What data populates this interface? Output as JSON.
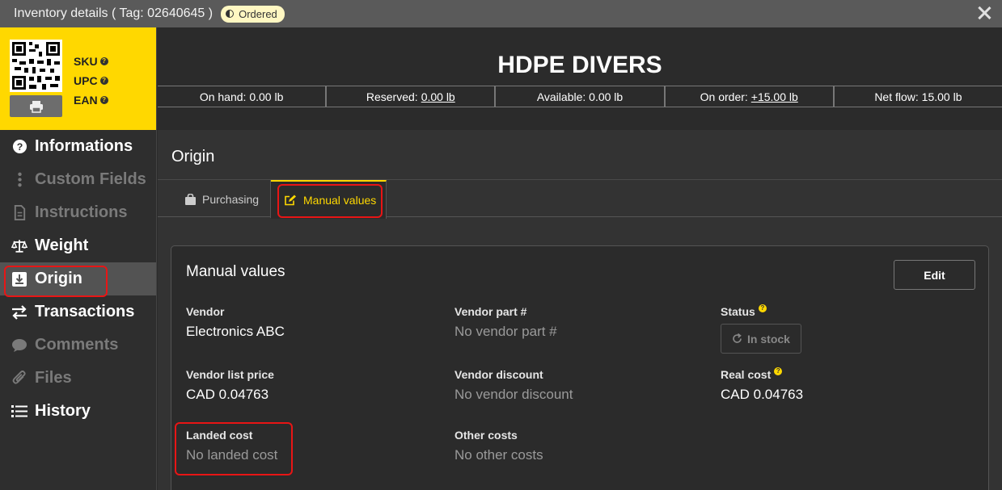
{
  "window": {
    "title": "Inventory details ( Tag: 02640645 )",
    "badge": "Ordered",
    "close_icon": "close-icon"
  },
  "sidebar": {
    "codes": [
      "SKU",
      "UPC",
      "EAN"
    ],
    "items": [
      {
        "label": "Informations",
        "icon": "question-circle-icon",
        "state": "normal"
      },
      {
        "label": "Custom Fields",
        "icon": "vertical-dots-icon",
        "state": "muted"
      },
      {
        "label": "Instructions",
        "icon": "document-icon",
        "state": "muted"
      },
      {
        "label": "Weight",
        "icon": "scale-icon",
        "state": "normal"
      },
      {
        "label": "Origin",
        "icon": "download-box-icon",
        "state": "active"
      },
      {
        "label": "Transactions",
        "icon": "arrows-exchange-icon",
        "state": "normal"
      },
      {
        "label": "Comments",
        "icon": "speech-bubble-icon",
        "state": "muted"
      },
      {
        "label": "Files",
        "icon": "paperclip-icon",
        "state": "muted"
      },
      {
        "label": "History",
        "icon": "list-icon",
        "state": "normal"
      }
    ]
  },
  "header": {
    "product": "HDPE DIVERS",
    "stats": [
      {
        "label": "On hand:",
        "value": "0.00 lb",
        "link": false
      },
      {
        "label": "Reserved:",
        "value": "0.00 lb",
        "link": true
      },
      {
        "label": "Available:",
        "value": "0.00 lb",
        "link": false
      },
      {
        "label": "On order:",
        "value": "+15.00 lb",
        "link": true
      },
      {
        "label": "Net flow:",
        "value": "15.00 lb",
        "link": false
      }
    ]
  },
  "content": {
    "section_title": "Origin",
    "tabs": [
      {
        "label": "Purchasing",
        "icon": "bag-icon",
        "active": false
      },
      {
        "label": "Manual values",
        "icon": "edit-icon",
        "active": true
      }
    ],
    "card": {
      "title": "Manual values",
      "edit_label": "Edit",
      "vendor": {
        "label": "Vendor",
        "value": "Electronics ABC"
      },
      "vendor_part": {
        "label": "Vendor part #",
        "value": "No vendor part #"
      },
      "status": {
        "label": "Status",
        "value": "In stock"
      },
      "vendor_list_price": {
        "label": "Vendor list price",
        "value": "CAD 0.04763"
      },
      "vendor_discount": {
        "label": "Vendor discount",
        "value": "No vendor discount"
      },
      "real_cost": {
        "label": "Real cost",
        "value": "CAD 0.04763"
      },
      "landed_cost": {
        "label": "Landed cost",
        "value": "No landed cost"
      },
      "other_costs": {
        "label": "Other costs",
        "value": "No other costs"
      }
    }
  },
  "colors": {
    "accent": "#ffd800",
    "highlight_box": "#e81515",
    "background": "#2b2b2b"
  }
}
